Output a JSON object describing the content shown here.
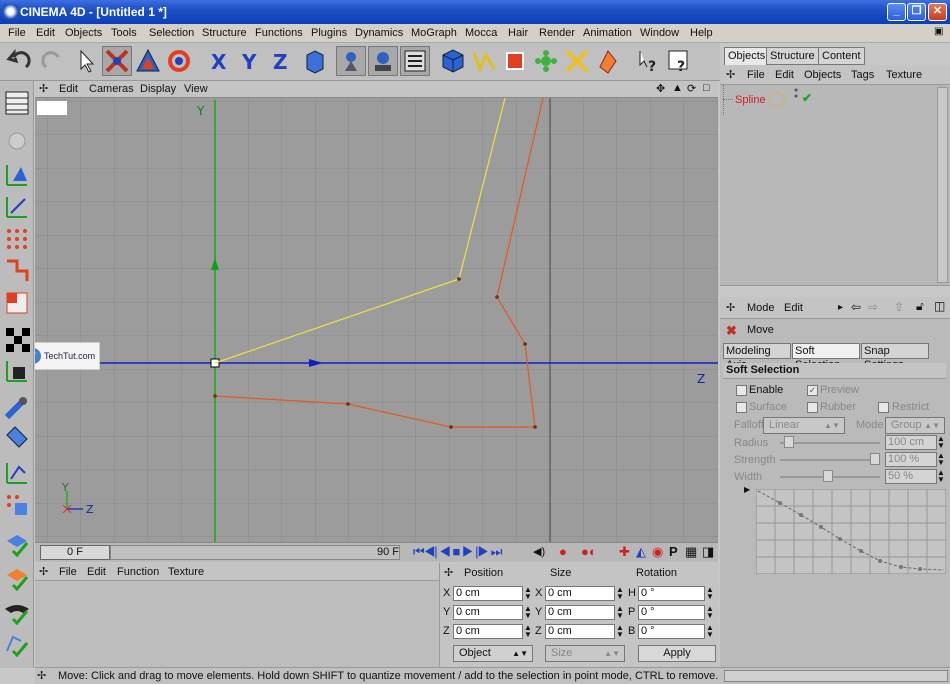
{
  "window": {
    "title": "CINEMA 4D - [Untitled 1 *]",
    "min": "_",
    "max": "❐",
    "close": "✕"
  },
  "menu": [
    "File",
    "Edit",
    "Objects",
    "Tools",
    "Selection",
    "Structure",
    "Functions",
    "Plugins",
    "Dynamics",
    "MoGraph",
    "Mocca",
    "Hair",
    "Render",
    "Animation",
    "Window",
    "Help"
  ],
  "viewport": {
    "menu": [
      "Edit",
      "Cameras",
      "Display",
      "View"
    ],
    "axis_y": "Y",
    "axis_z": "Z",
    "mini_y": "Y",
    "mini_z": "Z",
    "watermark": "TechTut.com"
  },
  "timeline": {
    "start": "0 F",
    "end": "90 F"
  },
  "materials": {
    "menu": [
      "File",
      "Edit",
      "Function",
      "Texture"
    ]
  },
  "coords": {
    "headers": [
      "Position",
      "Size",
      "Rotation"
    ],
    "rows": [
      {
        "l1": "X",
        "v1": "0 cm",
        "l2": "X",
        "v2": "0 cm",
        "l3": "H",
        "v3": "0 °"
      },
      {
        "l1": "Y",
        "v1": "0 cm",
        "l2": "Y",
        "v2": "0 cm",
        "l3": "P",
        "v3": "0 °"
      },
      {
        "l1": "Z",
        "v1": "0 cm",
        "l2": "Z",
        "v2": "0 cm",
        "l3": "B",
        "v3": "0 °"
      }
    ],
    "mode": "Object",
    "size_mode": "Size",
    "apply": "Apply"
  },
  "status": "Move: Click and drag to move elements. Hold down SHIFT to quantize movement / add to the selection in point mode, CTRL to remove.",
  "objects": {
    "tabs": [
      "Objects",
      "Structure",
      "Content"
    ],
    "menu": [
      "File",
      "Edit",
      "Objects",
      "Tags",
      "Texture"
    ],
    "items": [
      {
        "name": "Spline"
      }
    ]
  },
  "attributes": {
    "menu": [
      "Mode",
      "Edit"
    ],
    "tool": "Move",
    "tabs": [
      "Modeling Axis",
      "Soft Selection",
      "Snap Settings"
    ],
    "section": "Soft Selection",
    "enable": "Enable",
    "preview": "Preview",
    "surface": "Surface",
    "rubber": "Rubber",
    "restrict": "Restrict",
    "falloff_label": "Falloff",
    "falloff": "Linear",
    "mode_label": "Mode",
    "mode": "Group",
    "radius_label": "Radius",
    "radius": "100 cm",
    "strength_label": "Strength",
    "strength": "100 %",
    "width_label": "Width",
    "width": "50 %"
  },
  "colors": {
    "spline_yellow": "#f0e040",
    "spline_orange": "#e05a20",
    "axis_green": "#10b010",
    "axis_blue": "#1020c0",
    "title_blue": "#1d4fc6"
  }
}
